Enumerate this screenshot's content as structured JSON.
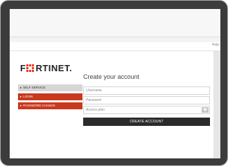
{
  "page": {
    "help_label": "Help"
  },
  "brand": {
    "logo_prefix": "F",
    "logo_rest": "RTINET."
  },
  "menu": {
    "items": [
      {
        "label": "SELF SERVICE",
        "style": "gray"
      },
      {
        "label": "LOGIN",
        "style": "red"
      },
      {
        "label": "PASSWORD CHANGE",
        "style": "red"
      }
    ]
  },
  "form": {
    "title": "Create your account",
    "username_placeholder": "Username",
    "password_placeholder": "Password",
    "access_plan_label": "Access plan",
    "submit_label": "CREATE ACCOUNT"
  },
  "colors": {
    "brand_red": "#ee3124",
    "menu_red": "#c8391e",
    "button_dark": "#2b2b2b"
  }
}
